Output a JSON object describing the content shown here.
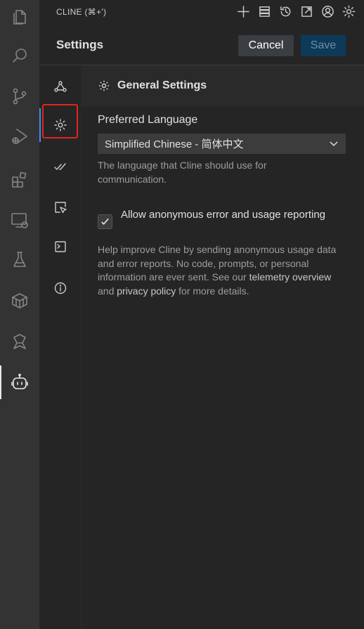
{
  "panel": {
    "title": "CLINE (⌘+')"
  },
  "header_icons": [
    "plus-icon",
    "server-icon",
    "history-icon",
    "external-link-icon",
    "account-icon",
    "gear-icon"
  ],
  "activity_bar": [
    "explorer-icon",
    "search-icon",
    "source-control-icon",
    "run-debug-icon",
    "extensions-icon",
    "remote-explorer-icon",
    "testing-icon",
    "containers-icon",
    "tools-icon",
    "cline-robot-icon"
  ],
  "settings": {
    "title": "Settings",
    "cancel_label": "Cancel",
    "save_label": "Save"
  },
  "tabs": [
    {
      "icon": "webhook-icon",
      "active": false
    },
    {
      "icon": "gear-icon",
      "active": true
    },
    {
      "icon": "check-all-icon",
      "active": false
    },
    {
      "icon": "browser-cursor-icon",
      "active": false
    },
    {
      "icon": "terminal-icon",
      "active": false
    },
    {
      "icon": "info-icon",
      "active": false
    }
  ],
  "general": {
    "section_title": "General Settings",
    "language_label": "Preferred Language",
    "language_value": "Simplified Chinese - 简体中文",
    "language_desc": "The language that Cline should use for communication.",
    "telemetry_label": "Allow anonymous error and usage reporting",
    "telemetry_checked": true,
    "telemetry_desc_1": "Help improve Cline by sending anonymous usage data and error reports. No code, prompts, or personal information are ever sent. See our ",
    "telemetry_link_1": "telemetry overview",
    "telemetry_desc_2": " and ",
    "telemetry_link_2": "privacy policy",
    "telemetry_desc_3": " for more details."
  },
  "colors": {
    "activity_bg": "#333333",
    "panel_bg": "#252526",
    "accent": "#3794ff",
    "highlight_box": "#e0251b",
    "save_bg": "#0e3a5a"
  }
}
